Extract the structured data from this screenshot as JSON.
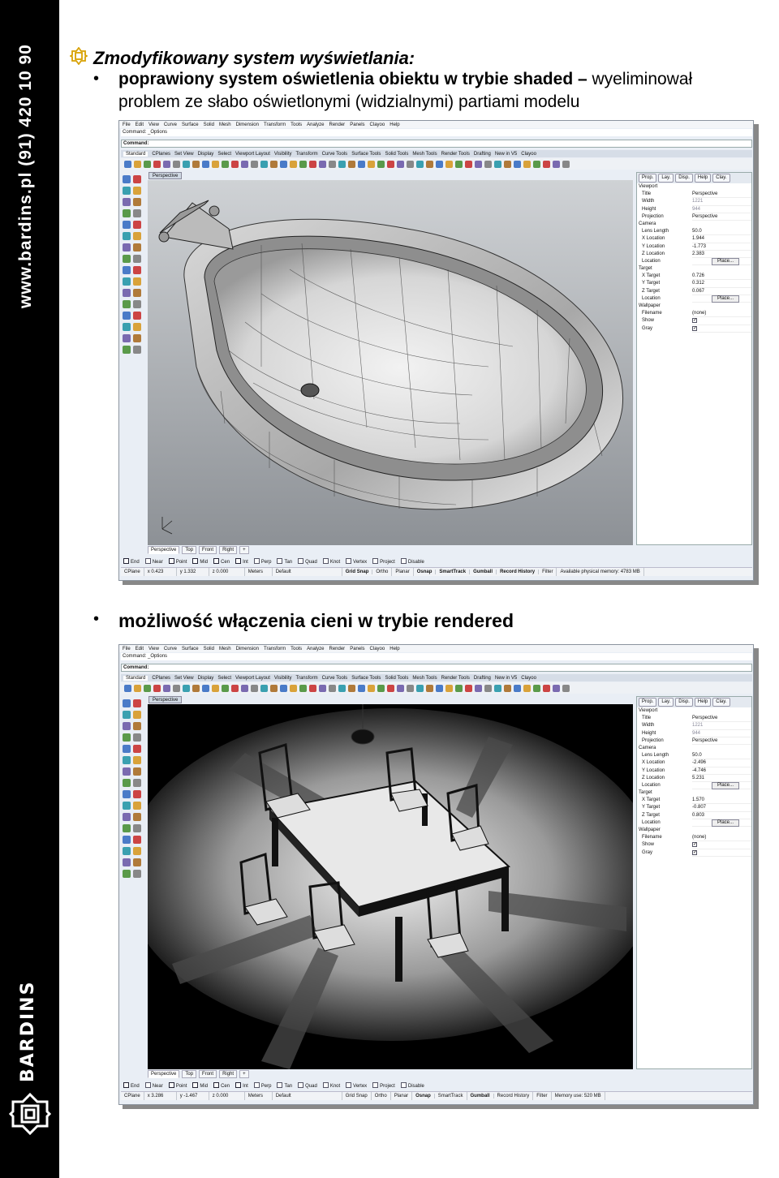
{
  "sidebar": {
    "url": "www.bardins.pl (91) 420 10 90",
    "brand": "BARDINS"
  },
  "heading": "Zmodyfikowany system wyświetlania:",
  "bullet1": {
    "bold": "poprawiony system oświetlenia obiektu w trybie shaded –",
    "normal": " wyeliminował",
    "line2": "problem ze słabo oświetlonymi (widzialnymi) partiami modelu"
  },
  "bullet2": "możliwość włączenia cieni w trybie rendered",
  "rhino": {
    "menu": [
      "File",
      "Edit",
      "View",
      "Curve",
      "Surface",
      "Solid",
      "Mesh",
      "Dimension",
      "Transform",
      "Tools",
      "Analyze",
      "Render",
      "Panels",
      "Clayoo",
      "Help"
    ],
    "cmd_history": "Command: _Options",
    "cmd_prompt": "Command:",
    "tabs": [
      "Standard",
      "CPlanes",
      "Set View",
      "Display",
      "Select",
      "Viewport Layout",
      "Visibility",
      "Transform",
      "Curve Tools",
      "Surface Tools",
      "Solid Tools",
      "Mesh Tools",
      "Render Tools",
      "Drafting",
      "New in V5",
      "Clayoo"
    ],
    "viewport_title": "Perspective",
    "viewport_tabs": [
      "Perspective",
      "Top",
      "Front",
      "Right",
      "+"
    ],
    "snaps": [
      "End",
      "Near",
      "Point",
      "Mid",
      "Cen",
      "Int",
      "Perp",
      "Tan",
      "Quad",
      "Knot",
      "Vertex",
      "Project",
      "Disable"
    ],
    "panel_tabs": [
      "Prop.",
      "Lay.",
      "Disp.",
      "Help",
      "Clay."
    ],
    "labels": {
      "viewport": "Viewport",
      "title": "Title",
      "width": "Width",
      "height": "Height",
      "projection": "Projection",
      "camera": "Camera",
      "lens": "Lens Length",
      "xloc": "X Location",
      "yloc": "Y Location",
      "zloc": "Z Location",
      "location": "Location",
      "target": "Target",
      "xt": "X Target",
      "yt": "Y Target",
      "zt": "Z Target",
      "wallpaper": "Wallpaper",
      "filename": "Filename",
      "show": "Show",
      "gray": "Gray",
      "place": "Place...",
      "none": "(none)"
    },
    "status_fixed": {
      "cplane": "CPlane",
      "units": "Meters",
      "layer": "Default",
      "grid": "Grid Snap",
      "ortho": "Ortho",
      "planar": "Planar",
      "osnap": "Osnap",
      "smarttrack": "SmartTrack",
      "gumball": "Gumball",
      "record": "Record History",
      "filter": "Filter"
    }
  },
  "window1": {
    "title": "Perspective",
    "width": "1221",
    "height": "944",
    "projection": "Perspective",
    "lens": "50.0",
    "xloc": "1.944",
    "yloc": "-1.773",
    "zloc": "2.383",
    "xt": "0.726",
    "yt": "0.312",
    "zt": "0.067",
    "x": "x 0.423",
    "y": "y 1.332",
    "z": "z 0.000",
    "memory": "Available physical memory: 4783 MB"
  },
  "window2": {
    "title": "Perspective",
    "width": "1221",
    "height": "944",
    "projection": "Perspective",
    "lens": "50.0",
    "xloc": "-2.496",
    "yloc": "-4.746",
    "zloc": "5.231",
    "xt": "1.570",
    "yt": "-0.807",
    "zt": "0.803",
    "x": "x 3.286",
    "y": "y -1.467",
    "z": "z 0.000",
    "memory": "Memory use: 520 MB"
  },
  "colors": {
    "sidebar": "#000000",
    "viewport_shaded": "#9ea2a6",
    "viewport_rendered": "#000000"
  }
}
